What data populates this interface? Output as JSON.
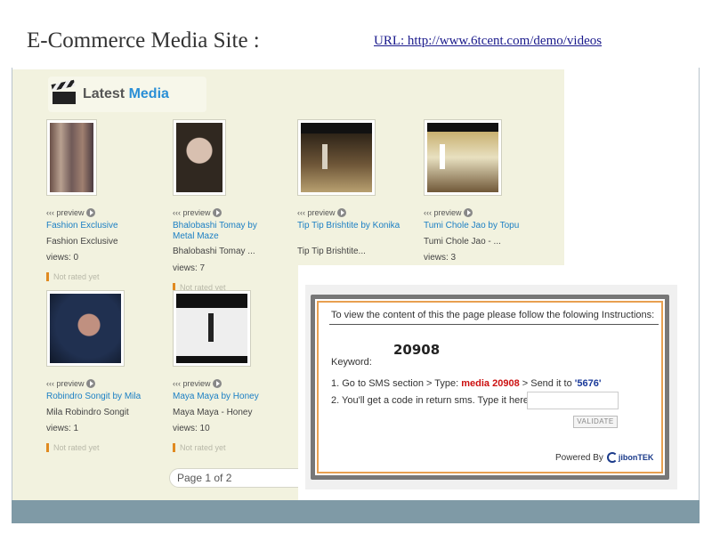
{
  "slide": {
    "title": "E-Commerce Media Site :",
    "url": "URL: http://www.6tcent.com/demo/videos"
  },
  "media": {
    "heading_word1": "Latest",
    "heading_word2": "Media",
    "preview_label": "‹‹‹ preview",
    "pagination": "Page 1 of 2",
    "cards": [
      {
        "title": "Fashion Exclusive",
        "subtitle": "Fashion Exclusive",
        "views": "views: 0",
        "rating": "Not rated yet"
      },
      {
        "title": "Bhalobashi Tomay by Metal Maze",
        "subtitle": "Bhalobashi Tomay ...",
        "views": "views: 7",
        "rating": "Not rated yet"
      },
      {
        "title": "Tip Tip Brishtite by Konika",
        "subtitle": "Tip Tip Brishtite...",
        "views": "",
        "rating": ""
      },
      {
        "title": "Tumi Chole Jao by Topu",
        "subtitle": "Tumi Chole Jao - ...",
        "views": "views: 3",
        "rating": ""
      },
      {
        "title": "Robindro Songit by Mila",
        "subtitle": "Mila Robindro Songit",
        "views": "views: 1",
        "rating": "Not rated yet"
      },
      {
        "title": "Maya Maya by Honey",
        "subtitle": "Maya Maya - Honey",
        "views": "views: 10",
        "rating": "Not rated yet"
      }
    ]
  },
  "sms": {
    "instructions": "To view the content of this the page please follow the folowing Instructions:",
    "keyword_value": "20908",
    "keyword_label": "Keyword:",
    "step1_prefix": "1. Go to SMS section",
    "step1_type": "> Type:",
    "step1_code": "media 20908",
    "step1_send": "> Send it to",
    "step1_number": "'5676'",
    "step2": "2. You'll get a code in return sms. Type it here:",
    "code_value": "",
    "validate_label": "VALIDATE",
    "powered_by": "Powered By",
    "brand_main": "jibonTEK"
  }
}
